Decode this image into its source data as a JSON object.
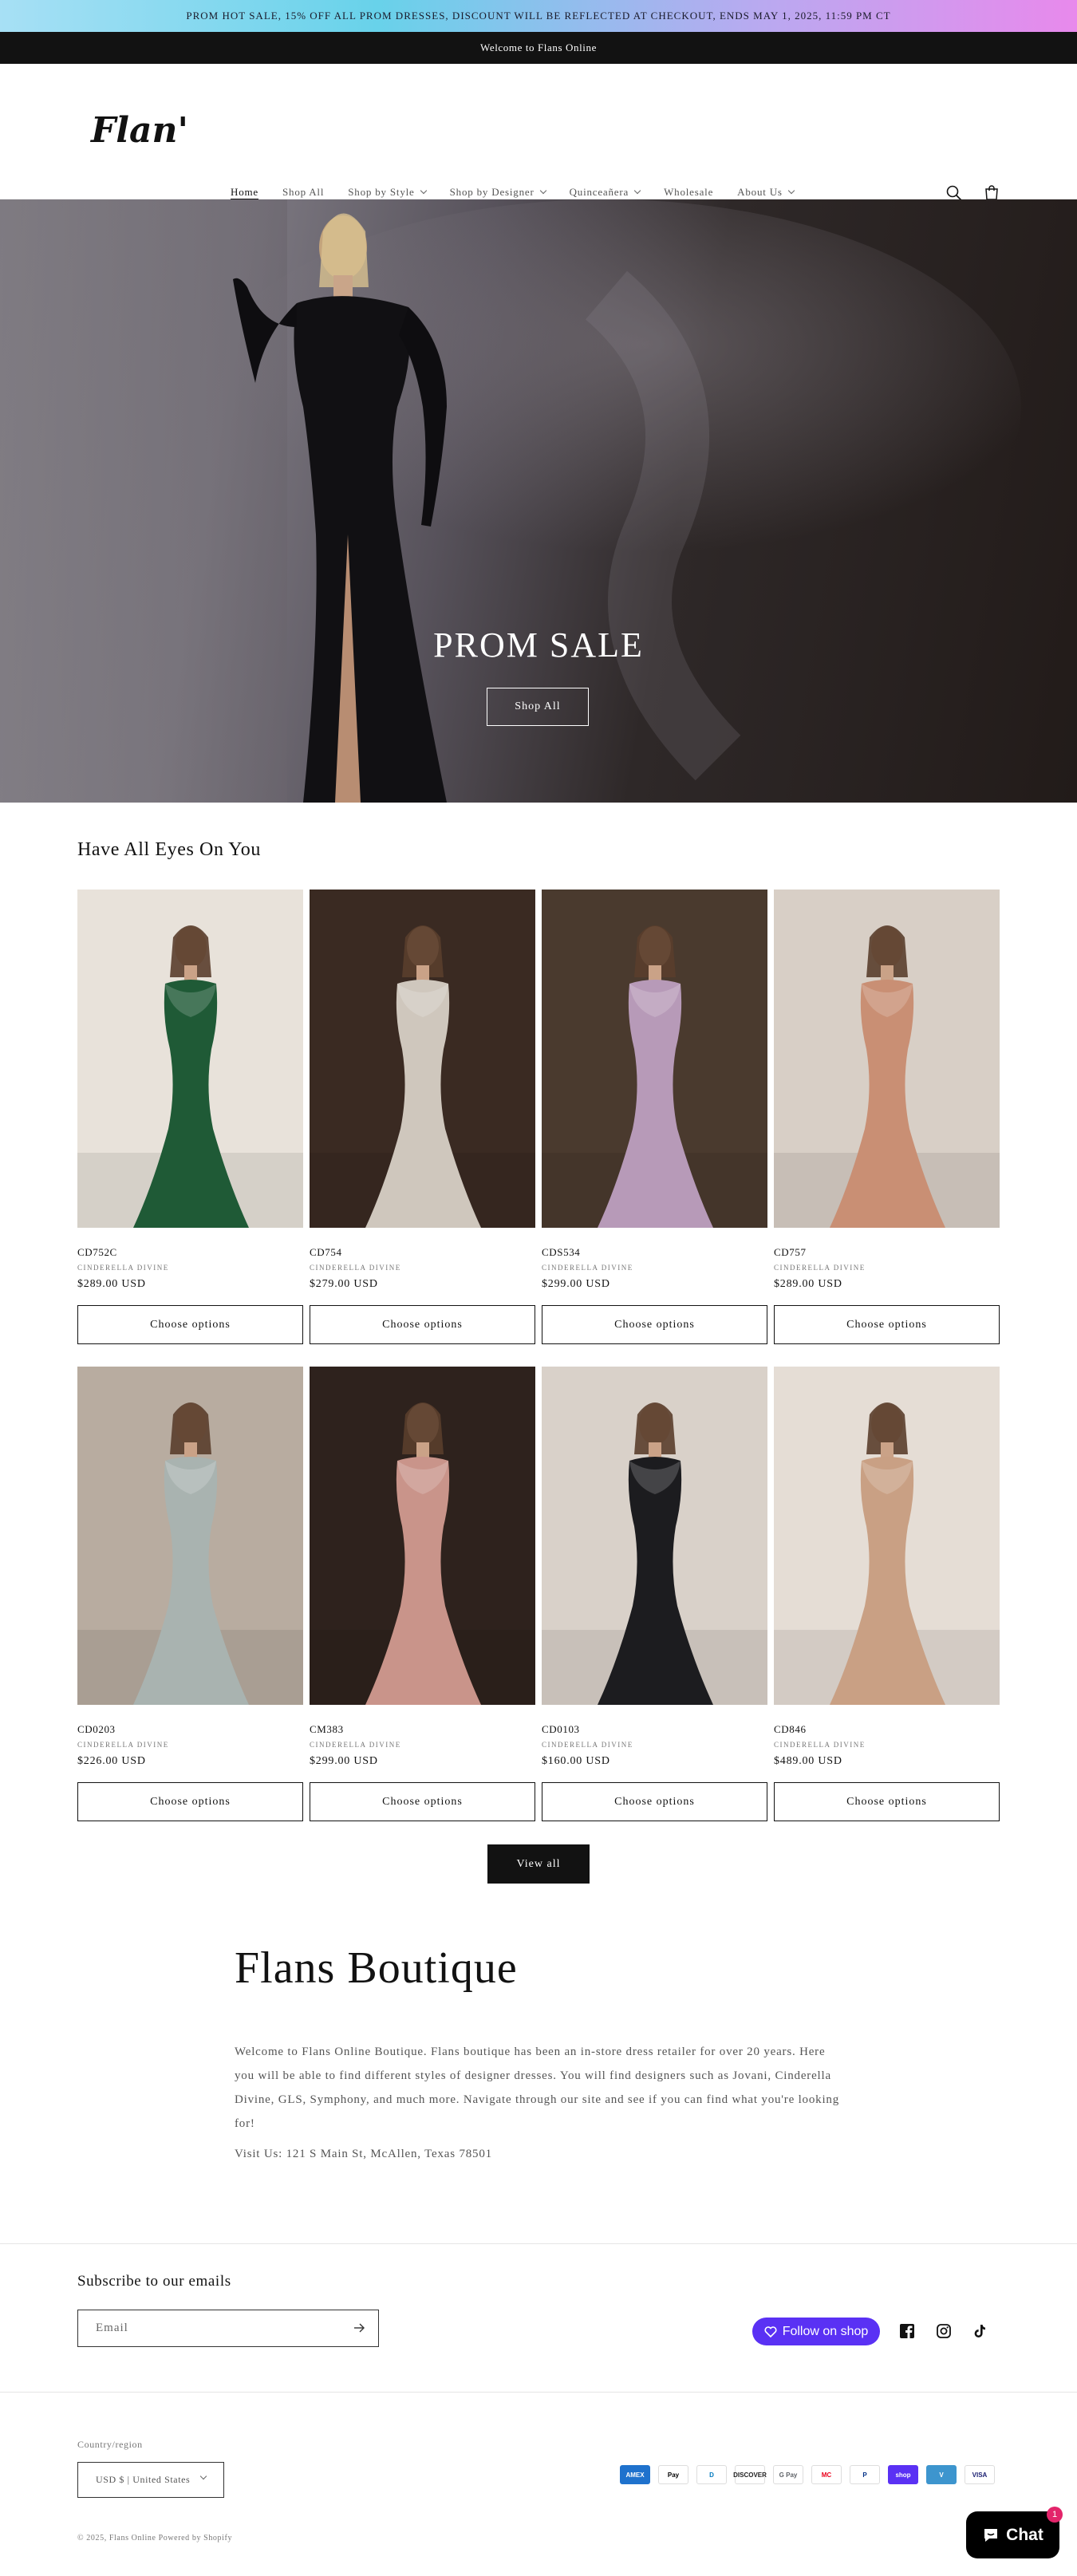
{
  "announcement": {
    "promo": "PROM HOT SALE, 15% OFF ALL PROM DRESSES, DISCOUNT WILL BE REFLECTED AT CHECKOUT, ENDS MAY 1, 2025, 11:59 PM CT",
    "welcome": "Welcome to Flans Online"
  },
  "header": {
    "logo_text": "Flan's",
    "nav": [
      {
        "label": "Home",
        "active": true,
        "dropdown": false
      },
      {
        "label": "Shop All",
        "active": false,
        "dropdown": false
      },
      {
        "label": "Shop by Style",
        "active": false,
        "dropdown": true
      },
      {
        "label": "Shop by Designer",
        "active": false,
        "dropdown": true
      },
      {
        "label": "Quinceañera",
        "active": false,
        "dropdown": true
      },
      {
        "label": "Wholesale",
        "active": false,
        "dropdown": false
      },
      {
        "label": "About Us",
        "active": false,
        "dropdown": true
      }
    ],
    "icons": [
      "search-icon",
      "cart-icon"
    ]
  },
  "hero": {
    "title": "PROM SALE",
    "button": "Shop All"
  },
  "collection": {
    "title": "Have All Eyes On You",
    "products": [
      {
        "name": "CD752C",
        "vendor": "CINDERELLA DIVINE",
        "price": "$289.00 USD",
        "button": "Choose options",
        "dress_color": "#1f5a36"
      },
      {
        "name": "CD754",
        "vendor": "CINDERELLA DIVINE",
        "price": "$279.00 USD",
        "button": "Choose options",
        "dress_color": "#cfc7bd"
      },
      {
        "name": "CDS534",
        "vendor": "CINDERELLA DIVINE",
        "price": "$299.00 USD",
        "button": "Choose options",
        "dress_color": "#b79ab8"
      },
      {
        "name": "CD757",
        "vendor": "CINDERELLA DIVINE",
        "price": "$289.00 USD",
        "button": "Choose options",
        "dress_color": "#c98f74"
      },
      {
        "name": "CD0203",
        "vendor": "CINDERELLA DIVINE",
        "price": "$226.00 USD",
        "button": "Choose options",
        "dress_color": "#a9b3b0"
      },
      {
        "name": "CM383",
        "vendor": "CINDERELLA DIVINE",
        "price": "$299.00 USD",
        "button": "Choose options",
        "dress_color": "#c9948a"
      },
      {
        "name": "CD0103",
        "vendor": "CINDERELLA DIVINE",
        "price": "$160.00 USD",
        "button": "Choose options",
        "dress_color": "#1c1c1f"
      },
      {
        "name": "CD846",
        "vendor": "CINDERELLA DIVINE",
        "price": "$489.00 USD",
        "button": "Choose options",
        "dress_color": "#c9a084"
      }
    ],
    "view_all": "View all"
  },
  "about": {
    "title": "Flans Boutique",
    "text": "Welcome to Flans Online Boutique. Flans boutique has been an in-store dress retailer for over 20 years. Here you will be able to find different styles of designer dresses. You will find designers such as Jovani, Cinderella Divine, GLS, Symphony, and much more. Navigate through our site and see if you can find what you're looking for!",
    "visit": "Visit Us: 121 S Main St, McAllen, Texas 78501"
  },
  "newsletter": {
    "title": "Subscribe to our emails",
    "placeholder": "Email",
    "follow": "Follow on shop",
    "social": [
      "facebook-icon",
      "instagram-icon",
      "tiktok-icon"
    ]
  },
  "footer": {
    "country_label": "Country/region",
    "country_value": "USD $ | United States",
    "payments": [
      {
        "name": "AMEX",
        "bg": "#1f72cd",
        "fg": "#ffffff"
      },
      {
        "name": "Pay",
        "bg": "#ffffff",
        "fg": "#000000"
      },
      {
        "name": "D",
        "bg": "#ffffff",
        "fg": "#0079be"
      },
      {
        "name": "DISCOVER",
        "bg": "#ffffff",
        "fg": "#222222"
      },
      {
        "name": "G Pay",
        "bg": "#ffffff",
        "fg": "#5f6368"
      },
      {
        "name": "MC",
        "bg": "#ffffff",
        "fg": "#eb001b"
      },
      {
        "name": "P",
        "bg": "#ffffff",
        "fg": "#003087"
      },
      {
        "name": "shop",
        "bg": "#5a31f4",
        "fg": "#ffffff"
      },
      {
        "name": "V",
        "bg": "#3d95ce",
        "fg": "#ffffff"
      },
      {
        "name": "VISA",
        "bg": "#ffffff",
        "fg": "#1a1f71"
      }
    ],
    "copyright": "© 2025, Flans Online Powered by Shopify"
  },
  "chat": {
    "label": "Chat",
    "badge": "1"
  }
}
